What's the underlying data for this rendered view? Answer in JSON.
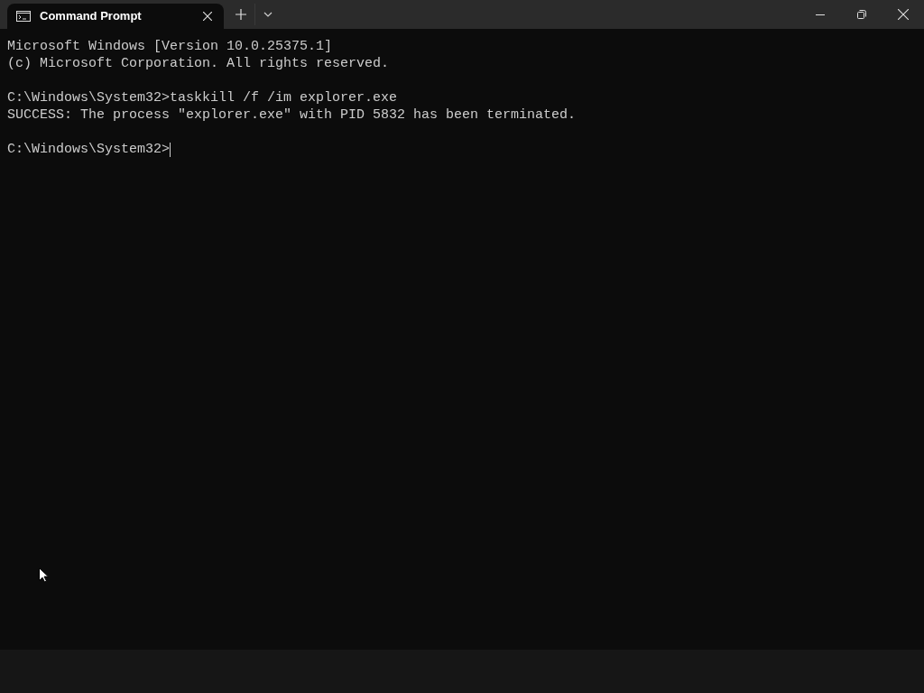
{
  "tabs": [
    {
      "title": "Command Prompt",
      "selected": true
    }
  ],
  "console": {
    "blocks": [
      [
        "Microsoft Windows [Version 10.0.25375.1]",
        "(c) Microsoft Corporation. All rights reserved."
      ],
      [
        "C:\\Windows\\System32>taskkill /f /im explorer.exe",
        "SUCCESS: The process \"explorer.exe\" with PID 5832 has been terminated."
      ],
      [
        "C:\\Windows\\System32>"
      ]
    ],
    "cursor_visible": true
  }
}
